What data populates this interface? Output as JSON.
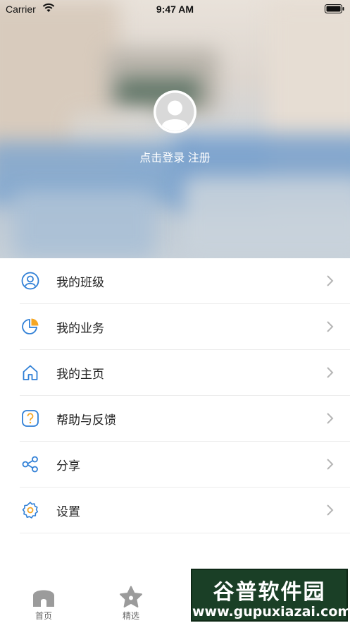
{
  "status_bar": {
    "carrier": "Carrier",
    "time": "9:47 AM"
  },
  "profile": {
    "login_text": "点击登录",
    "register_text": "注册"
  },
  "menu": {
    "items": [
      {
        "label": "我的班级",
        "icon": "user-circle-icon"
      },
      {
        "label": "我的业务",
        "icon": "pie-chart-icon"
      },
      {
        "label": "我的主页",
        "icon": "home-icon"
      },
      {
        "label": "帮助与反馈",
        "icon": "help-icon"
      },
      {
        "label": "分享",
        "icon": "share-icon"
      },
      {
        "label": "设置",
        "icon": "settings-icon"
      }
    ]
  },
  "tabbar": {
    "tabs": [
      {
        "label": "首页",
        "icon": "home-tab-icon"
      },
      {
        "label": "精选",
        "icon": "star-tab-icon"
      }
    ]
  },
  "watermark": {
    "title": "谷普软件园",
    "url": "www.gupuxiazai.com"
  },
  "colors": {
    "accent_blue": "#2f7fd6",
    "accent_orange": "#f5a623",
    "tab_gray": "#9b9b9b"
  }
}
